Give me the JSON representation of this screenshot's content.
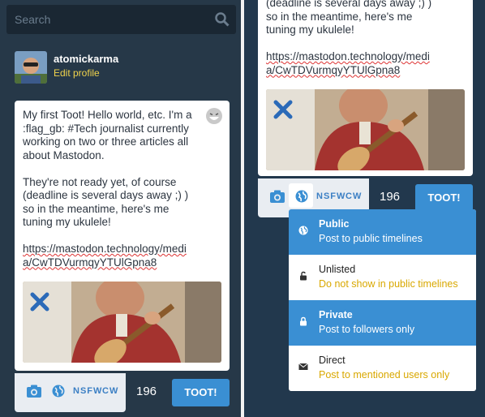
{
  "search": {
    "placeholder": "Search"
  },
  "profile": {
    "username": "atomickarma",
    "edit_label": "Edit profile"
  },
  "compose": {
    "lines": [
      "My first Toot! Hello world, etc. I'm a",
      ":flag_gb: #Tech journalist currently",
      "working on two or three articles all",
      "about Mastodon.",
      "",
      "They're not ready yet, of course",
      "(deadline is several days away ;) )",
      "so in the meantime, here's me",
      "tuning my ukulele!"
    ],
    "url_line1": "https://mastodon.technology/medi",
    "url_line2": "a/CwTDVurmqyYTUlGpna8"
  },
  "right_compose": {
    "lines": [
      "(deadline is several days away ;) )",
      "so in the meantime, here's me",
      "tuning my ukulele!"
    ],
    "url_line1": "https://mastodon.technology/medi",
    "url_line2": "a/CwTDVurmqyYTUlGpna8"
  },
  "toolbar": {
    "nsfw": "NSFW",
    "cw": "CW",
    "count": "196",
    "toot": "TOOT!"
  },
  "privacy_menu": [
    {
      "title": "Public",
      "subtitle": "Post to public timelines",
      "icon": "globe-icon",
      "active": true
    },
    {
      "title": "Unlisted",
      "subtitle": "Do not show in public timelines",
      "icon": "unlock-icon",
      "active": false
    },
    {
      "title": "Private",
      "subtitle": "Post to followers only",
      "icon": "lock-icon",
      "active": true
    },
    {
      "title": "Direct",
      "subtitle": "Post to mentioned users only",
      "icon": "envelope-icon",
      "active": false
    }
  ]
}
